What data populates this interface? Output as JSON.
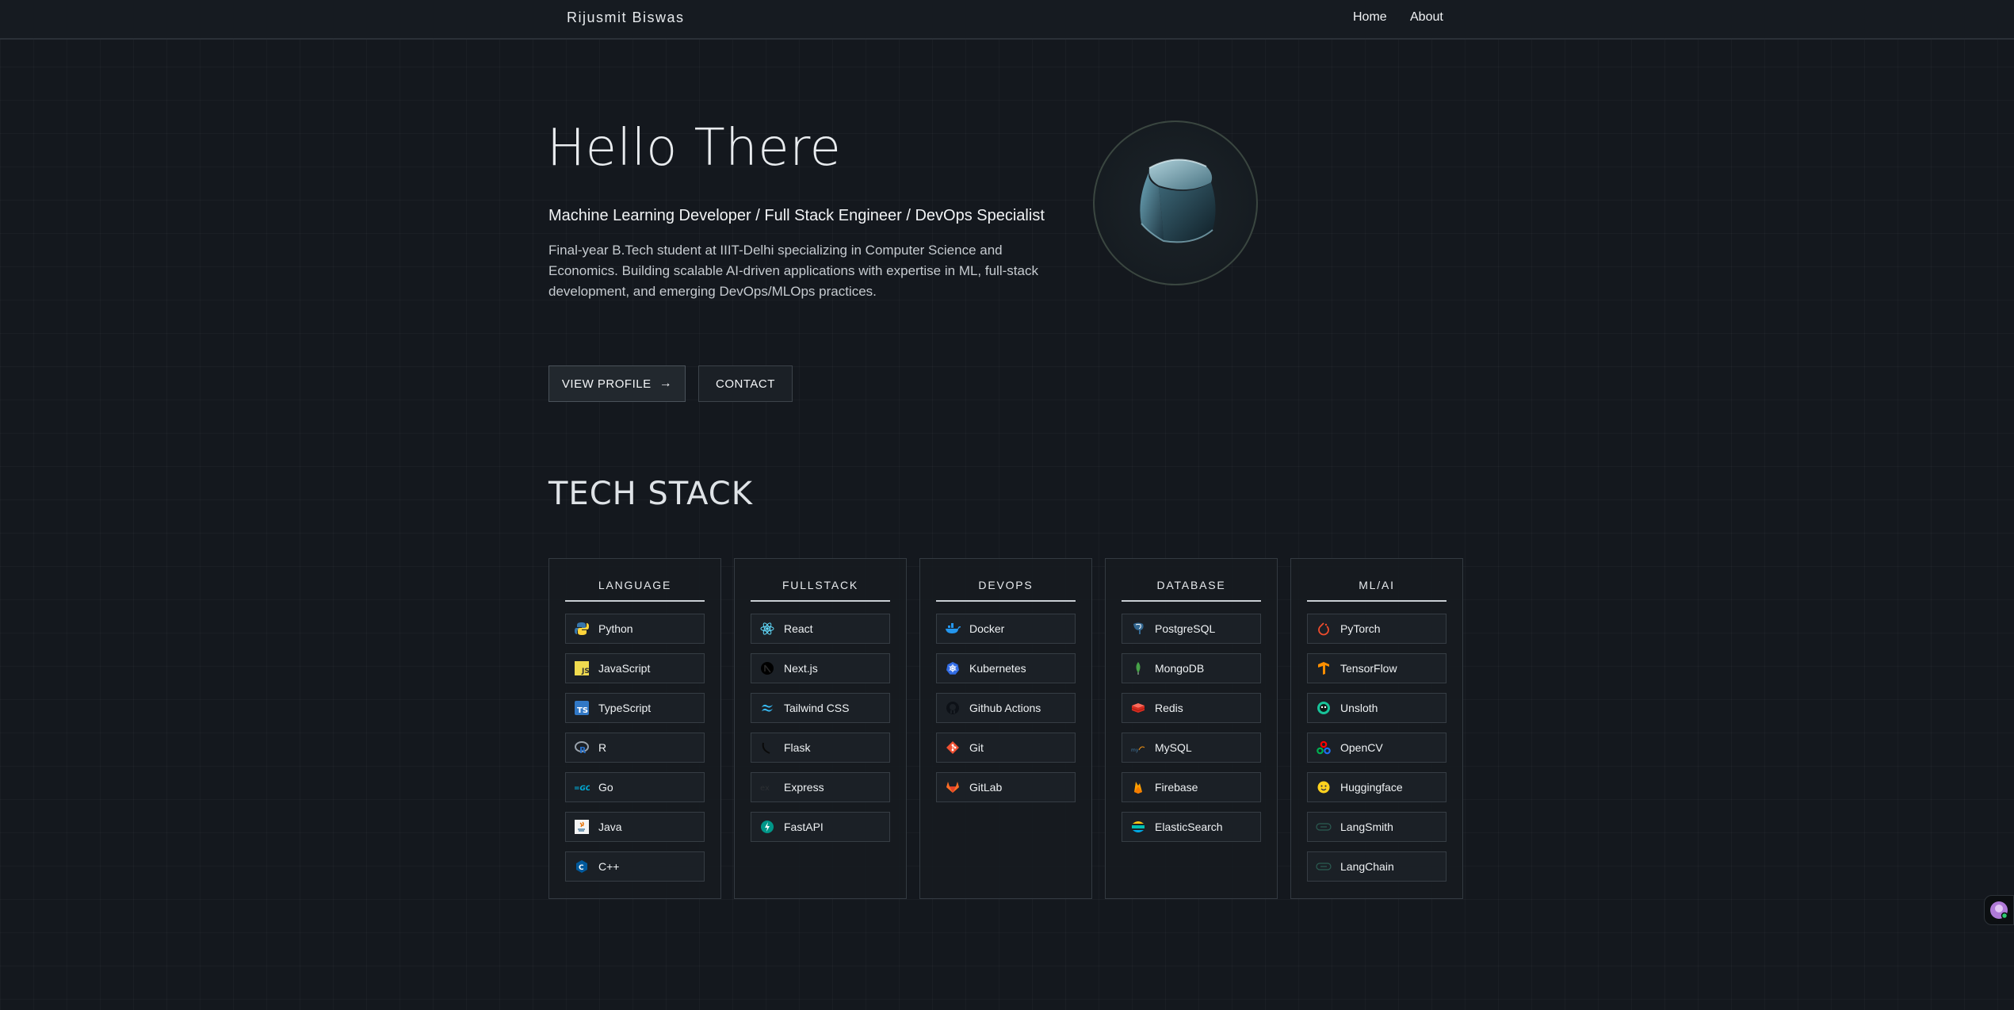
{
  "nav": {
    "brand": "Rijusmit Biswas",
    "links": [
      "Home",
      "About"
    ]
  },
  "hero": {
    "title": "Hello There",
    "subtitle": "Machine Learning Developer / Full Stack Engineer / DevOps Specialist",
    "description": "Final-year B.Tech student at IIIT-Delhi specializing in Computer Science and Economics. Building scalable AI-driven applications with expertise in ML, full-stack development, and emerging DevOps/MLOps practices.",
    "avatar_icon": "glass-cube-icon",
    "buttons": {
      "view_profile": "VIEW PROFILE",
      "contact": "CONTACT"
    }
  },
  "tech_stack": {
    "title": "TECH STACK",
    "categories": [
      {
        "name": "LANGUAGE",
        "items": [
          {
            "label": "Python",
            "icon": "python-icon"
          },
          {
            "label": "JavaScript",
            "icon": "javascript-icon"
          },
          {
            "label": "TypeScript",
            "icon": "typescript-icon"
          },
          {
            "label": "R",
            "icon": "r-icon"
          },
          {
            "label": "Go",
            "icon": "go-icon"
          },
          {
            "label": "Java",
            "icon": "java-icon"
          },
          {
            "label": "C++",
            "icon": "cpp-icon"
          }
        ]
      },
      {
        "name": "FULLSTACK",
        "items": [
          {
            "label": "React",
            "icon": "react-icon"
          },
          {
            "label": "Next.js",
            "icon": "nextjs-icon"
          },
          {
            "label": "Tailwind CSS",
            "icon": "tailwind-icon"
          },
          {
            "label": "Flask",
            "icon": "flask-icon"
          },
          {
            "label": "Express",
            "icon": "express-icon"
          },
          {
            "label": "FastAPI",
            "icon": "fastapi-icon"
          }
        ]
      },
      {
        "name": "DEVOPS",
        "items": [
          {
            "label": "Docker",
            "icon": "docker-icon"
          },
          {
            "label": "Kubernetes",
            "icon": "kubernetes-icon"
          },
          {
            "label": "Github Actions",
            "icon": "github-icon"
          },
          {
            "label": "Git",
            "icon": "git-icon"
          },
          {
            "label": "GitLab",
            "icon": "gitlab-icon"
          }
        ]
      },
      {
        "name": "DATABASE",
        "items": [
          {
            "label": "PostgreSQL",
            "icon": "postgresql-icon"
          },
          {
            "label": "MongoDB",
            "icon": "mongodb-icon"
          },
          {
            "label": "Redis",
            "icon": "redis-icon"
          },
          {
            "label": "MySQL",
            "icon": "mysql-icon"
          },
          {
            "label": "Firebase",
            "icon": "firebase-icon"
          },
          {
            "label": "ElasticSearch",
            "icon": "elasticsearch-icon"
          }
        ]
      },
      {
        "name": "ML/AI",
        "items": [
          {
            "label": "PyTorch",
            "icon": "pytorch-icon"
          },
          {
            "label": "TensorFlow",
            "icon": "tensorflow-icon"
          },
          {
            "label": "Unsloth",
            "icon": "unsloth-icon"
          },
          {
            "label": "OpenCV",
            "icon": "opencv-icon"
          },
          {
            "label": "Huggingface",
            "icon": "huggingface-icon"
          },
          {
            "label": "LangSmith",
            "icon": "langsmith-icon"
          },
          {
            "label": "LangChain",
            "icon": "langchain-icon"
          }
        ]
      }
    ]
  },
  "widgets": {
    "chat_icon": "chat-avatar-icon"
  }
}
